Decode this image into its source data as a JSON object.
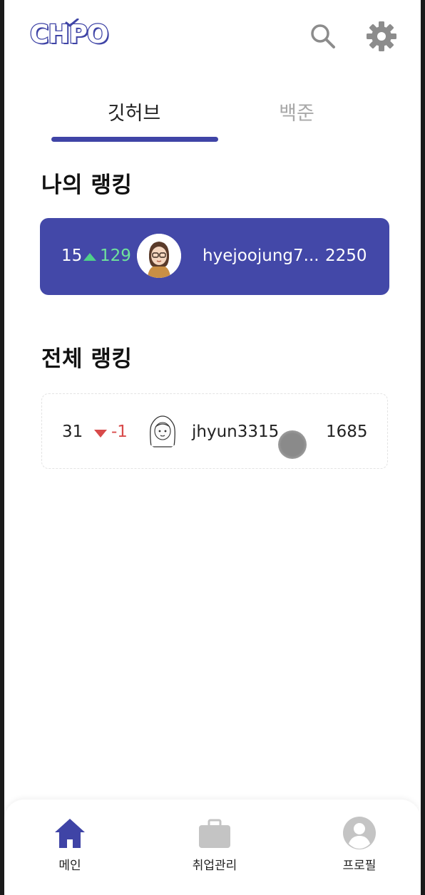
{
  "app": {
    "logo_text": "CHPO"
  },
  "header": {
    "search_icon": "search-icon",
    "settings_icon": "gear-icon"
  },
  "tabs": [
    {
      "label": "깃허브",
      "active": true
    },
    {
      "label": "백준",
      "active": false
    }
  ],
  "my_ranking": {
    "title": "나의 랭킹",
    "rank": "15",
    "change": "129",
    "change_direction": "up",
    "username": "hyejoojung7...",
    "score": "2250"
  },
  "all_ranking": {
    "title": "전체 랭킹",
    "rows": [
      {
        "rank": "31",
        "change": "-1",
        "change_direction": "down",
        "username": "jhyun3315",
        "score": "1685"
      }
    ]
  },
  "bottom_nav": [
    {
      "label": "메인",
      "icon": "home-icon",
      "active": true
    },
    {
      "label": "취업관리",
      "icon": "briefcase-icon",
      "active": false
    },
    {
      "label": "프로필",
      "icon": "user-icon",
      "active": false
    }
  ],
  "colors": {
    "brand": "#3f44a6",
    "card": "#4348a8",
    "up": "#4fd08a",
    "down": "#d84a4a",
    "inactive_tab": "#a8a8a8"
  }
}
